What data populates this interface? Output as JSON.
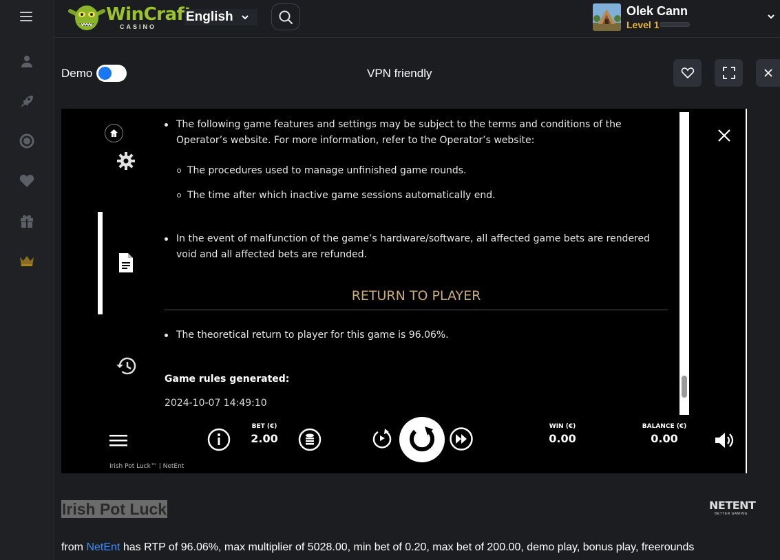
{
  "header": {
    "logo_text": "WinCraft",
    "logo_sub": "CASINO",
    "language": "English",
    "user": {
      "name": "Olek Cann",
      "level": "Level 1",
      "level_progress": 0.0
    }
  },
  "toolbar": {
    "demo_label": "Demo",
    "demo_on": true,
    "vpn_label": "VPN friendly"
  },
  "sidebar": {
    "items": [
      {
        "icon": "user-icon"
      },
      {
        "icon": "rocket-icon"
      },
      {
        "icon": "roulette-icon"
      },
      {
        "icon": "heart-icon"
      },
      {
        "icon": "gift-icon"
      },
      {
        "icon": "crown-icon"
      }
    ]
  },
  "rules": {
    "bullet1": "The following game features and settings may be subject to the terms and conditions of the Operator’s website. For more information, refer to the Operator’s website:",
    "sub1": "The procedures used to manage unfinished game rounds.",
    "sub2": "The time after which inactive game sessions automatically end.",
    "bullet2": "In the event of malfunction of the game’s hardware/software, all affected game bets are rendered void and all affected bets are refunded.",
    "rtp_heading": "RETURN TO PLAYER",
    "rtp_text": "The theoretical return to player for this game is 96.06%.",
    "generated_label": "Game rules generated:",
    "generated_date": "2024-10-07 14:49:10"
  },
  "controls": {
    "bet_label": "BET (€)",
    "bet_value": "2.00",
    "win_label": "WIN (€)",
    "win_value": "0.00",
    "balance_label": "BALANCE (€)",
    "balance_value": "0.00",
    "footer": "Irish Pot Luck™  |  NetEnt"
  },
  "game": {
    "title": "Irish Pot Luck",
    "provider_logo": "NETENT",
    "provider_tagline": "BETTER GAMING",
    "desc_prefix": "from ",
    "desc_provider": "NetEnt",
    "desc_suffix": " has RTP of 96.06%, max multiplier of 5028.00, min bet of 0.20, max bet of 200.00, demo play, bonus play, freerounds"
  }
}
